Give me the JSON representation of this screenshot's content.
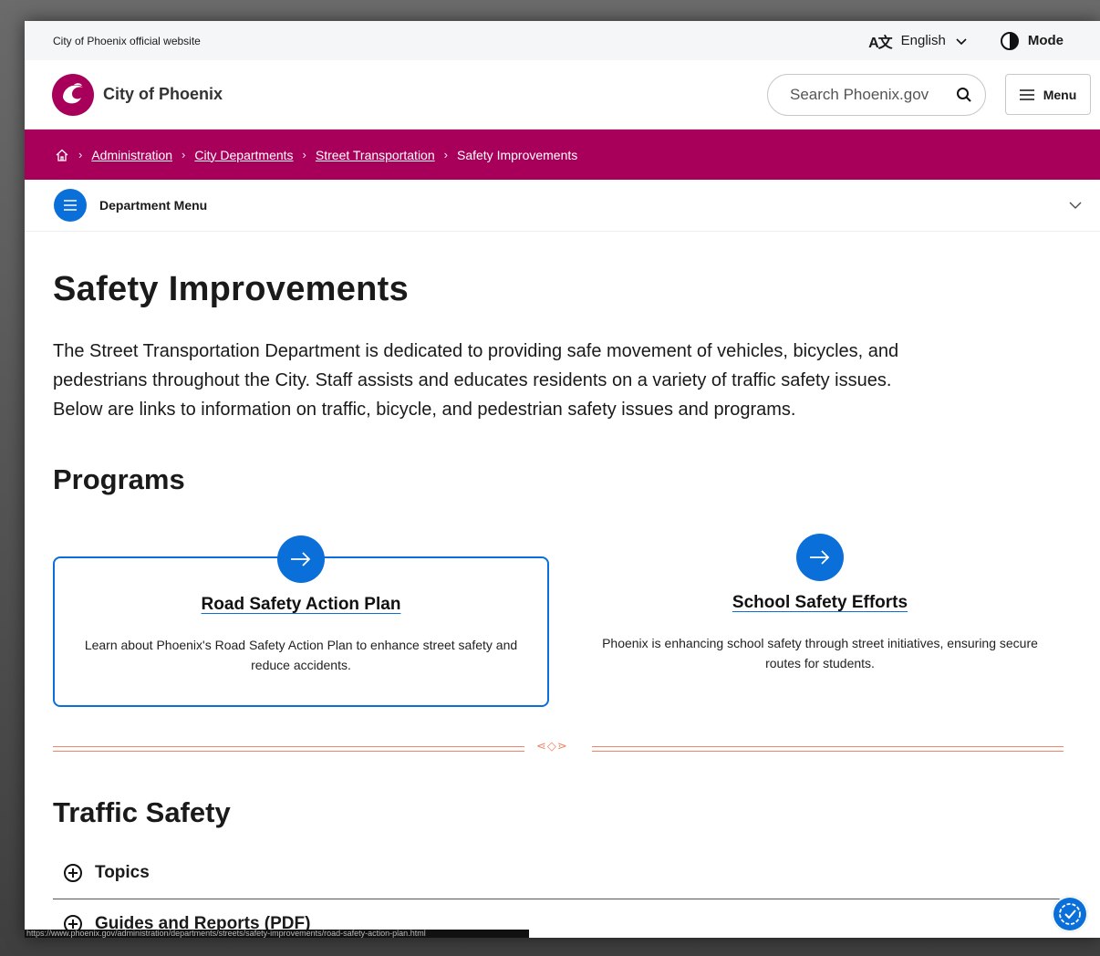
{
  "utility": {
    "site_label": "City of Phoenix official website",
    "language_glyph": "A文",
    "language": "English",
    "mode": "Mode"
  },
  "header": {
    "brand": "City of Phoenix",
    "search_placeholder": "Search Phoenix.gov",
    "menu_label": "Menu",
    "brand_color": "#a8005a"
  },
  "breadcrumb": {
    "items": [
      "Administration",
      "City Departments",
      "Street Transportation"
    ],
    "current": "Safety Improvements",
    "separator": "›"
  },
  "department_menu": {
    "label": "Department Menu"
  },
  "main": {
    "title": "Safety Improvements",
    "intro": "The Street Transportation Department is dedicated to providing safe movement of vehicles, bicycles, and pedestrians throughout the City. Staff assists and educates residents on a variety of traffic safety issues. Below are links to information on traffic, bicycle, and pedestrian safety issues and programs.",
    "programs_heading": "Programs",
    "cards": [
      {
        "title": "Road Safety Action Plan",
        "description": "Learn about Phoenix's Road Safety Action Plan to enhance street safety and reduce accidents."
      },
      {
        "title": "School Safety Efforts",
        "description": "Phoenix is enhancing school safety through street initiatives, ensuring secure routes for students."
      }
    ],
    "traffic_heading": "Traffic Safety",
    "accordion": [
      "Topics",
      "Guides and Reports (PDF)"
    ]
  },
  "status_url": "https://www.phoenix.gov/administration/departments/streets/safety-improvements/road-safety-action-plan.html",
  "accent_color": "#0b6fd9"
}
